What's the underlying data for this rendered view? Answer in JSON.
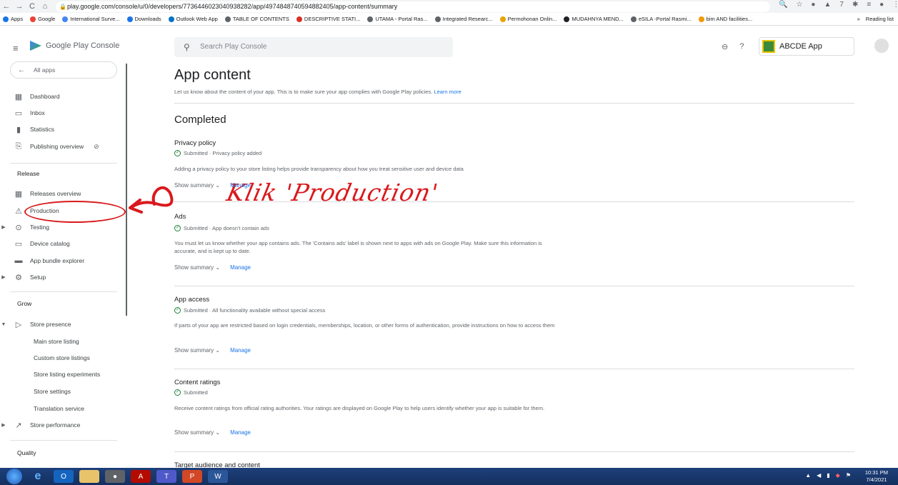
{
  "browser": {
    "url": "play.google.com/console/u/0/developers/7736446023040938282/app/4974848740594882405/app-content/summary",
    "bookmarks": [
      "Apps",
      "Google",
      "International Surve...",
      "Downloads",
      "Outlook Web App",
      "TABLE OF CONTENTS",
      "DESCRIPTIVE STATI...",
      "UTAMA - Portal Ras...",
      "Integrated Researc...",
      "Permohonan Onlin...",
      "MUDAHNYA MEND...",
      "eSILA -Portal Rasmi...",
      "bim AND facilities..."
    ],
    "reading_list": "Reading list"
  },
  "header": {
    "logo_text": "Google Play Console",
    "search_placeholder": "Search Play Console",
    "app_name": "ABCDE App"
  },
  "sidebar": {
    "all_apps": "All apps",
    "top_items": [
      "Dashboard",
      "Inbox",
      "Statistics",
      "Publishing overview"
    ],
    "release_heading": "Release",
    "release_items": [
      "Releases overview",
      "Production",
      "Testing",
      "Device catalog",
      "App bundle explorer",
      "Setup"
    ],
    "grow_heading": "Grow",
    "store_presence": "Store presence",
    "store_presence_sub": [
      "Main store listing",
      "Custom store listings",
      "Store listing experiments",
      "Store settings",
      "Translation service"
    ],
    "store_performance": "Store performance",
    "quality_heading": "Quality"
  },
  "annotation": {
    "text": "Klik 'Production'",
    "color": "#d9191c"
  },
  "main": {
    "title": "App content",
    "subtitle": "Let us know about the content of your app. This is to make sure your app complies with Google Play policies.",
    "learn_more": "Learn more",
    "completed_heading": "Completed",
    "show_summary": "Show summary",
    "manage": "Manage",
    "sections": [
      {
        "title": "Privacy policy",
        "status": "Submitted · Privacy policy added",
        "desc": "Adding a privacy policy to your store listing helps provide transparency about how you treat sensitive user and device data"
      },
      {
        "title": "Ads",
        "status": "Submitted · App doesn't contain ads",
        "desc": "You must let us know whether your app contains ads. The 'Contains ads' label is shown next to apps with ads on Google Play. Make sure this information is accurate, and is kept up to date."
      },
      {
        "title": "App access",
        "status": "Submitted · All functionality available without special access",
        "desc": "If parts of your app are restricted based on login credentials, memberships, location, or other forms of authentication, provide instructions on how to access them"
      },
      {
        "title": "Content ratings",
        "status": "Submitted",
        "desc": "Receive content ratings from official rating authorities. Your ratings are displayed on Google Play to help users identify whether your app is suitable for them."
      },
      {
        "title": "Target audience and content",
        "status": "",
        "desc": ""
      }
    ]
  },
  "taskbar": {
    "time": "10:31 PM",
    "date": "7/4/2021"
  }
}
